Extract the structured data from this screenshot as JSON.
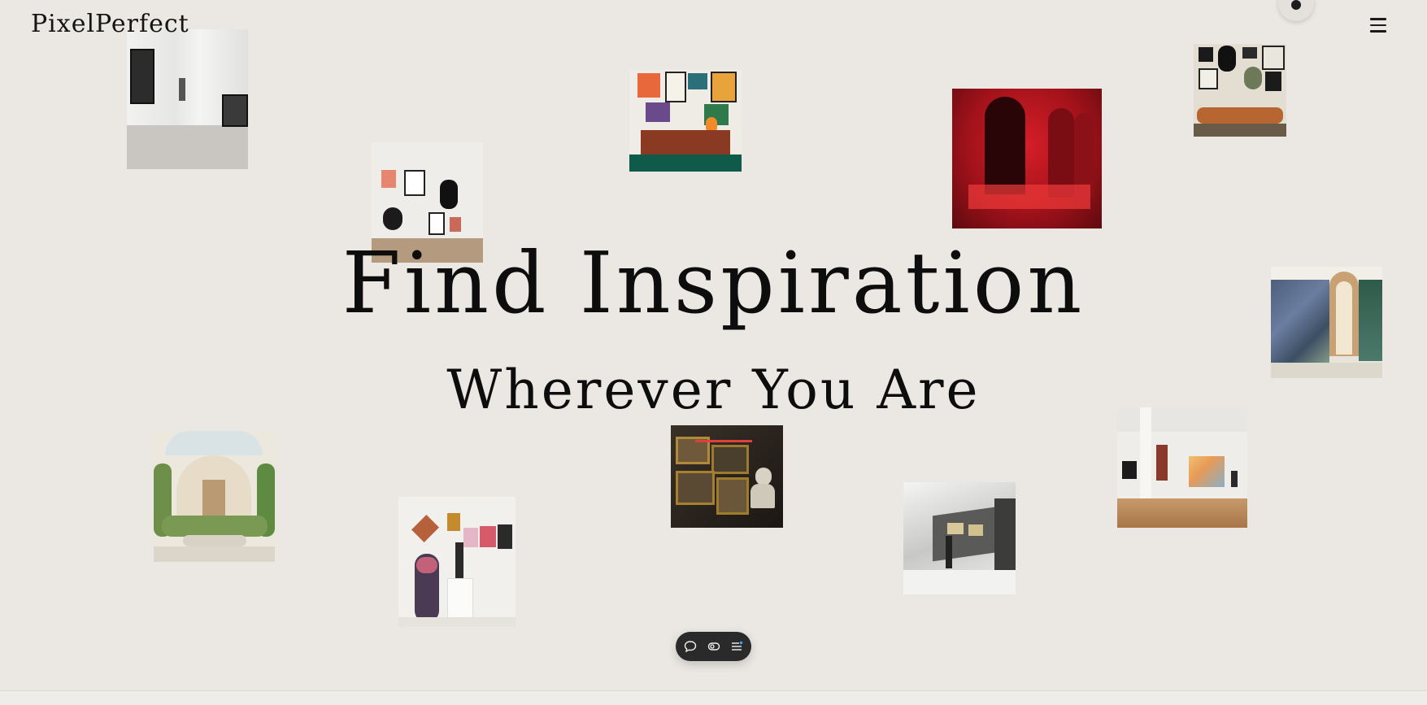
{
  "header": {
    "logo_text": "PixelPerfect",
    "menu_icon": "hamburger-menu-icon"
  },
  "hero": {
    "title": "Find Inspiration",
    "subtitle": "Wherever You Are"
  },
  "gallery": {
    "images": [
      {
        "name": "gallery-image-white-corridor",
        "description_icon": "image"
      },
      {
        "name": "gallery-image-framed-wall",
        "description_icon": "image"
      },
      {
        "name": "gallery-image-colorful-sideboard",
        "description_icon": "image"
      },
      {
        "name": "gallery-image-red-arches",
        "description_icon": "image"
      },
      {
        "name": "gallery-image-abstract-wall-bench",
        "description_icon": "image"
      },
      {
        "name": "gallery-image-water-lilies-room",
        "description_icon": "image"
      },
      {
        "name": "gallery-image-atrium-garden",
        "description_icon": "image"
      },
      {
        "name": "gallery-image-sculpture-room",
        "description_icon": "image"
      },
      {
        "name": "gallery-image-old-masters-bust",
        "description_icon": "image"
      },
      {
        "name": "gallery-image-modern-gallery-statue",
        "description_icon": "image"
      },
      {
        "name": "gallery-image-wood-floor-gallery",
        "description_icon": "image"
      }
    ]
  },
  "toolbar": {
    "icons": [
      "chat-bubble-icon",
      "view-toggle-icon",
      "list-menu-icon"
    ]
  },
  "colors": {
    "background": "#ebe8e4",
    "text": "#0d0d0d",
    "toolbar": "#2a2a2a"
  }
}
